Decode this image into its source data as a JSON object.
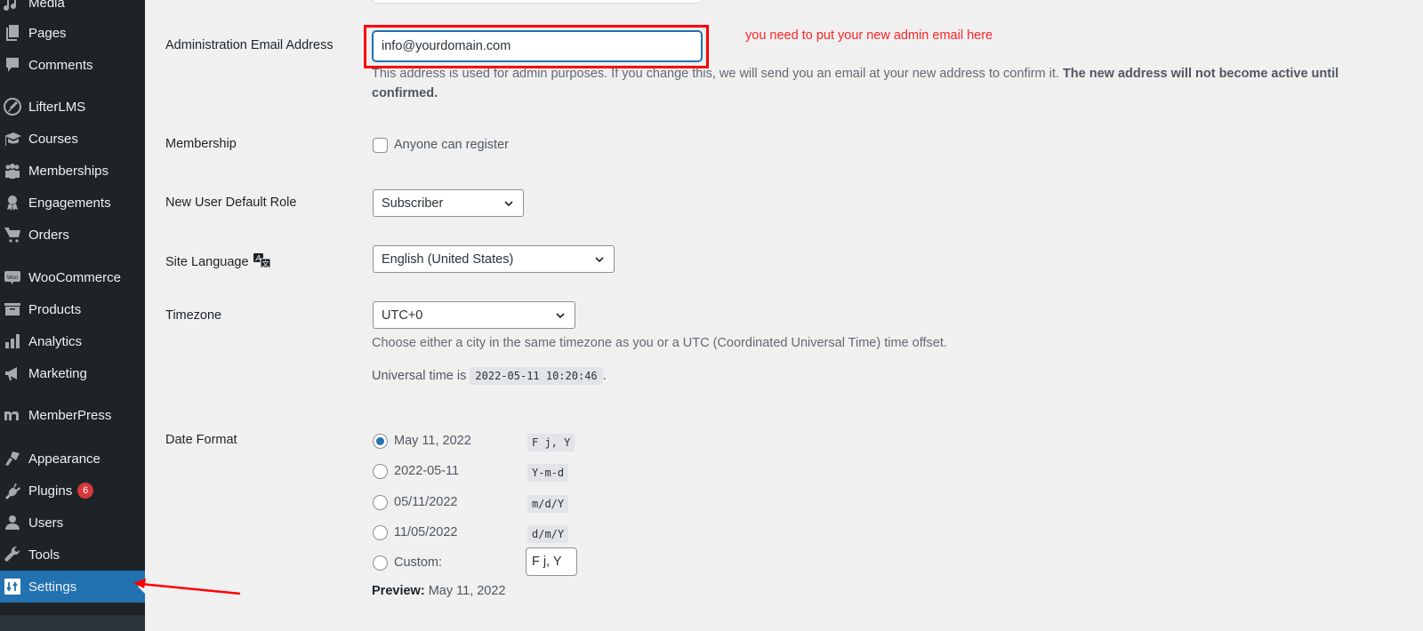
{
  "sidebar": {
    "items": [
      {
        "label": "Media",
        "icon": "media-icon"
      },
      {
        "label": "Pages",
        "icon": "pages-icon"
      },
      {
        "label": "Comments",
        "icon": "comments-icon"
      },
      {
        "label": "LifterLMS",
        "icon": "lifterlms-rocket-icon"
      },
      {
        "label": "Courses",
        "icon": "graduation-cap-icon"
      },
      {
        "label": "Memberships",
        "icon": "group-icon"
      },
      {
        "label": "Engagements",
        "icon": "award-ribbon-icon"
      },
      {
        "label": "Orders",
        "icon": "cart-icon"
      },
      {
        "label": "WooCommerce",
        "icon": "woo-icon"
      },
      {
        "label": "Products",
        "icon": "archive-box-icon"
      },
      {
        "label": "Analytics",
        "icon": "bar-chart-icon"
      },
      {
        "label": "Marketing",
        "icon": "megaphone-icon"
      },
      {
        "label": "MemberPress",
        "icon": "memberpress-m-icon"
      },
      {
        "label": "Appearance",
        "icon": "paintbrush-icon"
      },
      {
        "label": "Plugins",
        "icon": "plug-icon",
        "badge": "6"
      },
      {
        "label": "Users",
        "icon": "user-icon"
      },
      {
        "label": "Tools",
        "icon": "wrench-icon"
      },
      {
        "label": "Settings",
        "icon": "settings-sliders-icon",
        "active": true
      }
    ]
  },
  "settings": {
    "admin_email": {
      "label": "Administration Email Address",
      "value": "info@yourdomain.com",
      "description": "This address is used for admin purposes. If you change this, we will send you an email at your new address to confirm it.",
      "description_bold": "The new address will not become active until confirmed."
    },
    "annotation": "you need to put your new admin email here",
    "membership": {
      "label": "Membership",
      "checkbox_label": "Anyone can register",
      "checked": false
    },
    "default_role": {
      "label": "New User Default Role",
      "selected": "Subscriber"
    },
    "site_language": {
      "label": "Site Language",
      "selected": "English (United States)"
    },
    "timezone": {
      "label": "Timezone",
      "selected": "UTC+0",
      "description": "Choose either a city in the same timezone as you or a UTC (Coordinated Universal Time) time offset.",
      "universal_prefix": "Universal time is",
      "universal_time": "2022-05-11 10:20:46",
      "universal_suffix": "."
    },
    "date_format": {
      "label": "Date Format",
      "options": [
        {
          "label": "May 11, 2022",
          "code": "F j, Y",
          "checked": true
        },
        {
          "label": "2022-05-11",
          "code": "Y-m-d",
          "checked": false
        },
        {
          "label": "05/11/2022",
          "code": "m/d/Y",
          "checked": false
        },
        {
          "label": "11/05/2022",
          "code": "d/m/Y",
          "checked": false
        },
        {
          "label": "Custom:",
          "checked": false
        }
      ],
      "custom_value": "F j, Y",
      "preview_label": "Preview:",
      "preview_value": "May 11, 2022"
    }
  },
  "colors": {
    "accent": "#2271b1",
    "annotation_red": "#ff0000",
    "badge": "#d63638",
    "sidebar_bg": "#1d2327"
  }
}
